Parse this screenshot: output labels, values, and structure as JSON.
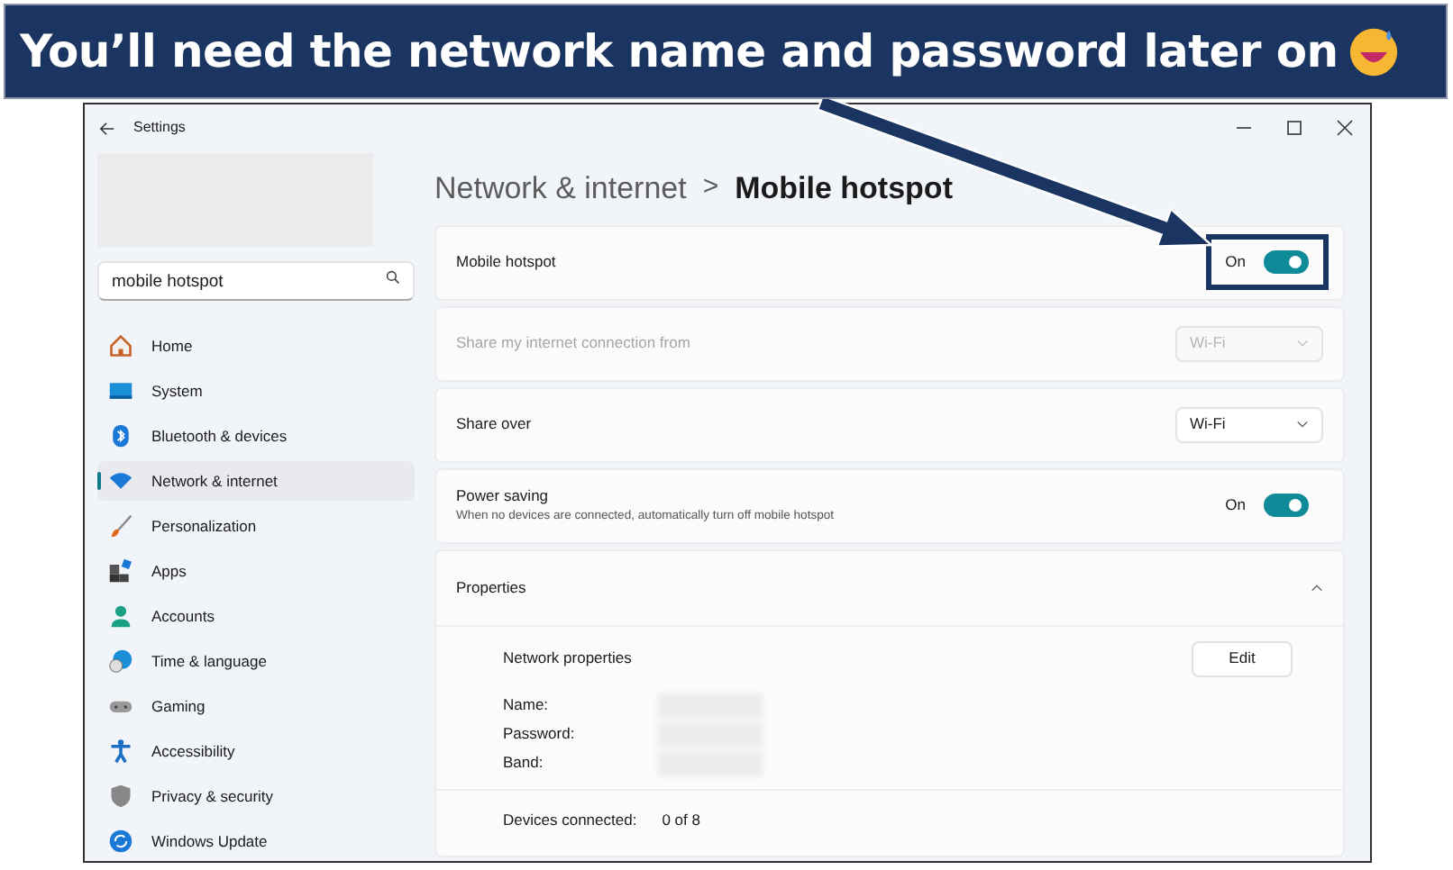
{
  "banner": {
    "text": "You’ll need the network name and password later on"
  },
  "window": {
    "title": "Settings"
  },
  "search": {
    "value": "mobile hotspot"
  },
  "sidebar": {
    "items": [
      {
        "label": "Home",
        "selected": false
      },
      {
        "label": "System",
        "selected": false
      },
      {
        "label": "Bluetooth & devices",
        "selected": false
      },
      {
        "label": "Network & internet",
        "selected": true
      },
      {
        "label": "Personalization",
        "selected": false
      },
      {
        "label": "Apps",
        "selected": false
      },
      {
        "label": "Accounts",
        "selected": false
      },
      {
        "label": "Time & language",
        "selected": false
      },
      {
        "label": "Gaming",
        "selected": false
      },
      {
        "label": "Accessibility",
        "selected": false
      },
      {
        "label": "Privacy & security",
        "selected": false
      },
      {
        "label": "Windows Update",
        "selected": false
      }
    ]
  },
  "breadcrumb": {
    "parent": "Network & internet",
    "separator": ">",
    "current": "Mobile hotspot"
  },
  "settings": [
    {
      "kind": "toggle",
      "label": "Mobile hotspot",
      "state_text": "On",
      "on": true,
      "callout": true
    },
    {
      "kind": "dropdown",
      "label": "Share my internet connection from",
      "value": "Wi-Fi",
      "disabled": true
    },
    {
      "kind": "dropdown",
      "label": "Share over",
      "value": "Wi-Fi",
      "disabled": false
    },
    {
      "kind": "toggle",
      "label": "Power saving",
      "description": "When no devices are connected, automatically turn off mobile hotspot",
      "state_text": "On",
      "on": true,
      "callout": false
    }
  ],
  "properties": {
    "title": "Properties",
    "expanded": true,
    "heading": "Network properties",
    "edit_button": "Edit",
    "fields": [
      {
        "label": "Name:",
        "redacted": true
      },
      {
        "label": "Password:",
        "redacted": true
      },
      {
        "label": "Band:",
        "redacted": true
      }
    ],
    "devices": {
      "label": "Devices connected:",
      "value": "0 of 8"
    }
  }
}
